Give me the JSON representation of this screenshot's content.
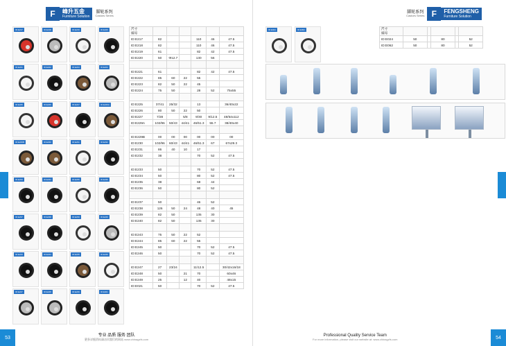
{
  "left": {
    "page_number": "53",
    "brand": {
      "logo": "F",
      "name_cn": "峰升五金",
      "name_en": "Furniture Solution",
      "series_cn": "脚轮系列",
      "series_en": "Castors Series"
    },
    "table": {
      "header_left_top": "尺寸",
      "header_left_bottom": "编号",
      "rows": [
        [
          "ID:E217",
          "82",
          "",
          "",
          "110",
          "46",
          "47.5"
        ],
        [
          "ID:E218",
          "82",
          "",
          "",
          "110",
          "46",
          "47.5"
        ],
        [
          "ID:E219",
          "61",
          "",
          "",
          "82",
          "42",
          "47.5"
        ],
        [
          "ID:E220",
          "50",
          "Φ12.7",
          "",
          "130",
          "56",
          ""
        ],
        [
          "ID:E221",
          "61",
          "",
          "",
          "82",
          "42",
          "47.5"
        ],
        [
          "ID:E222",
          "85",
          "60",
          "22",
          "55",
          "",
          ""
        ],
        [
          "ID:E223",
          "82",
          "50",
          "22",
          "45",
          "",
          ""
        ],
        [
          "ID:E224",
          "75",
          "50",
          "",
          "28",
          "52",
          "75x55"
        ],
        [
          "ID:E225",
          "37/41",
          "25/32",
          "",
          "13",
          "",
          "36/40x22"
        ],
        [
          "ID:E226",
          "80",
          "50",
          "22",
          "50",
          "",
          ""
        ],
        [
          "ID:E227",
          "7/28",
          "",
          "5/8",
          "9/30",
          "9/12.5",
          "48/54x112"
        ],
        [
          "ID:E229A",
          "102/96",
          "50/43",
          "44/41",
          "46/51.3",
          "55.7",
          "38/40x40"
        ],
        [
          "ID:E229B",
          "00",
          "00",
          "00",
          "00",
          "00",
          "00"
        ],
        [
          "ID:E230",
          "102/96",
          "60/43",
          "44/41",
          "46/51.3",
          "67",
          "67x29.3"
        ],
        [
          "ID:E231",
          "86",
          "40",
          "10",
          "17",
          "",
          ""
        ],
        [
          "ID:E232",
          "38",
          "",
          "",
          "70",
          "52",
          "47.5"
        ],
        [
          "ID:E233",
          "50",
          "",
          "",
          "70",
          "52",
          "47.5"
        ],
        [
          "ID:E234",
          "50",
          "",
          "",
          "80",
          "52",
          "47.5"
        ],
        [
          "ID:E235",
          "38",
          "",
          "",
          "68",
          "44",
          ""
        ],
        [
          "ID:E236",
          "50",
          "",
          "",
          "80",
          "52",
          ""
        ],
        [
          "ID:E237",
          "50",
          "",
          "",
          "46",
          "52",
          ""
        ],
        [
          "ID:E238",
          "126",
          "50",
          "24",
          "48",
          "40",
          "45"
        ],
        [
          "ID:E239",
          "82",
          "50",
          "",
          "135",
          "30",
          ""
        ],
        [
          "ID:E240",
          "82",
          "50",
          "",
          "135",
          "30",
          ""
        ],
        [
          "ID:E243",
          "75",
          "50",
          "22",
          "52",
          "",
          ""
        ],
        [
          "ID:E244",
          "85",
          "60",
          "22",
          "55",
          "",
          ""
        ],
        [
          "ID:E245",
          "50",
          "",
          "",
          "70",
          "52",
          "47.5"
        ],
        [
          "ID:E246",
          "50",
          "",
          "",
          "70",
          "52",
          "47.5"
        ],
        [
          "ID:E247",
          "27",
          "23/24",
          "",
          "11/12.5",
          "",
          "30/42x16/18"
        ],
        [
          "ID:E248",
          "50",
          "",
          "21",
          "70",
          "",
          "60x46"
        ],
        [
          "ID:E249",
          "25",
          "",
          "12",
          "40",
          "",
          "48x15"
        ],
        [
          "ID:E021",
          "50",
          "",
          "",
          "70",
          "52",
          "47.5"
        ]
      ]
    },
    "footer": {
      "title": "专业  品质  服务  团队",
      "sub": "更多详细资料请访问我们的网站 www.chinagzfs.com"
    }
  },
  "right": {
    "page_number": "54",
    "brand": {
      "logo": "F",
      "name_cn": "FENGSHENG",
      "name_en": "Furniture Solution",
      "series_cn": "脚轮系列",
      "series_en": "Castors Series"
    },
    "table": {
      "header_left_top": "尺寸",
      "header_left_bottom": "编号",
      "rows": [
        [
          "ID:E024",
          "50",
          "",
          "80",
          "",
          "52"
        ],
        [
          "ID:E062",
          "50",
          "",
          "80",
          "",
          "52"
        ]
      ]
    },
    "footer": {
      "title": "Professional  Quality  Service  Team",
      "sub": "For more information, please visit our website at: www.chinagzfs.com"
    }
  }
}
